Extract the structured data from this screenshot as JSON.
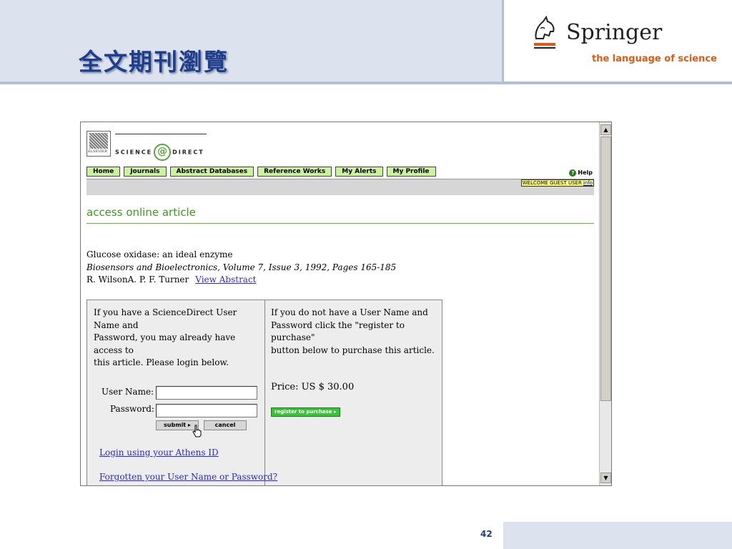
{
  "slide": {
    "title": "全文期刊瀏覽",
    "page_number": "42"
  },
  "logo": {
    "name": "Springer",
    "tagline": "the language of science"
  },
  "sciencedirect": {
    "publisher_label": "ELSEVIER",
    "brand_left": "SCIENCE",
    "brand_right": "DIRECT",
    "nav": [
      "Home",
      "Journals",
      "Abstract Databases",
      "Reference Works",
      "My Alerts",
      "My Profile"
    ],
    "help": "Help",
    "welcome": "WELCOME GUEST USER",
    "info": "info",
    "section_title": "access online article"
  },
  "article": {
    "title": "Glucose oxidase: an ideal enzyme",
    "journal": "Biosensors and Bioelectronics, Volume 7, Issue 3, 1992, Pages 165-185",
    "authors": "R. WilsonA. P. F. Turner",
    "view_abstract": "View Abstract"
  },
  "login": {
    "intro": "If you have a ScienceDirect User\nName and\nPassword, you may already have\naccess to\nthis article. Please login below.",
    "username_label": "User Name:",
    "password_label": "Password:",
    "username_value": "",
    "password_value": "",
    "submit": "submit ▸",
    "cancel": "cancel",
    "athens_link": "Login using your Athens ID",
    "forgot_link": "Forgotten your User Name or Password?"
  },
  "purchase": {
    "intro": "If you do not have a User Name and\nPassword click the \"register to\npurchase\"\nbutton below to purchase this article.",
    "price": "Price: US $ 30.00",
    "register_button": "register to purchase ▸"
  },
  "colors": {
    "title_blue": "#1e3d8f",
    "header_band": "#dce3ee",
    "sd_green": "#3d9a1e",
    "nav_green": "#ccf2a0",
    "springer_orange": "#e05a13",
    "link_blue": "#2a2ad0"
  }
}
